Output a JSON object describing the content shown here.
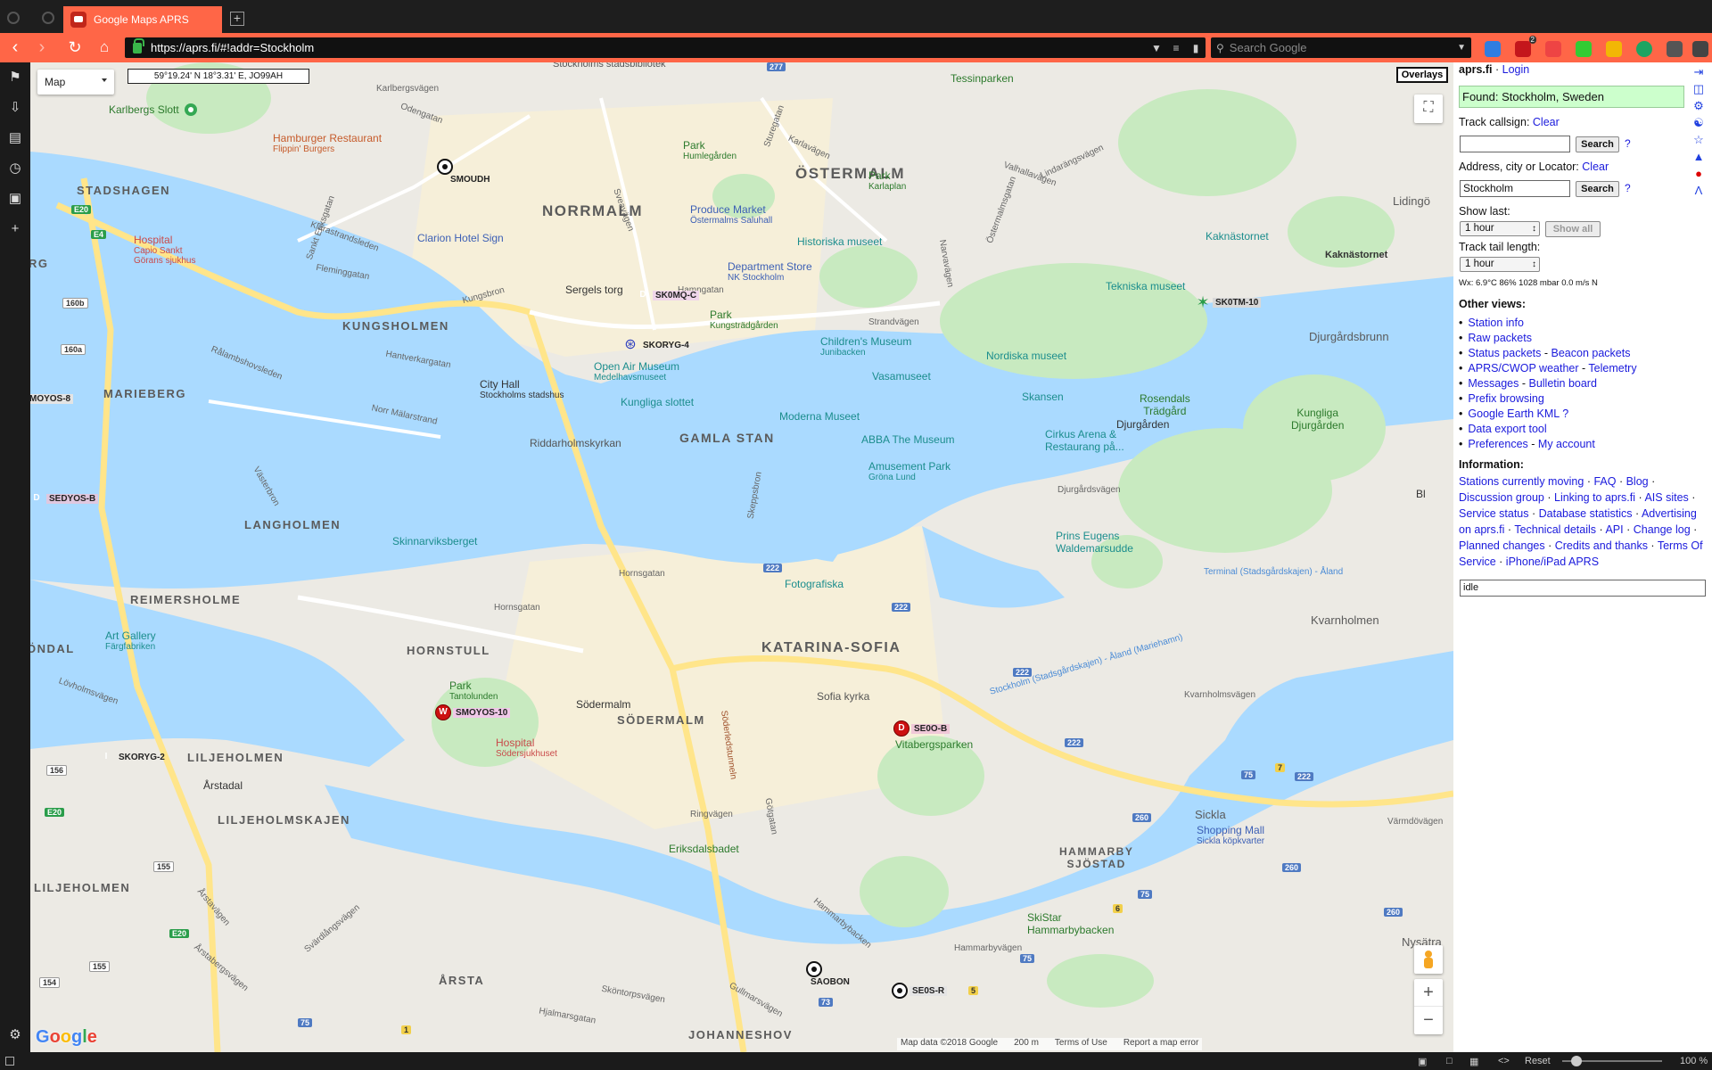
{
  "browser": {
    "tab_title": "Google Maps APRS",
    "new_tab": "+",
    "url": "https://aprs.fi/#!addr=Stockholm",
    "search_placeholder": "Search Google",
    "extension_badge": "2",
    "status": {
      "reset": "Reset",
      "zoom": "100 %"
    }
  },
  "map": {
    "map_type": "Map",
    "coords": "59°19.24' N 18°3.31' E, JO99AH",
    "overlays": "Overlays",
    "zoom_in": "+",
    "zoom_out": "−",
    "attribution": {
      "data": "Map data ©2018 Google",
      "scale": "200 m",
      "terms": "Terms of Use",
      "report": "Report a map error"
    },
    "districts": {
      "ostermalm": "ÖSTERMALM",
      "norrmalm": "NORRMALM",
      "kungsholmen": "KUNGSHOLMEN",
      "marieberg": "MARIEBERG",
      "stadshagen": "STADSHAGEN",
      "gamla_stan": "GAMLA STAN",
      "langholmen": "LANGHOLMEN",
      "reimersholme": "REIMERSHOLME",
      "hornstull": "HORNSTULL",
      "sodermalm": "SÖDERMALM",
      "katarina_sofia": "KATARINA-SOFIA",
      "liljeholmskajen": "LILJEHOLMSKAJEN",
      "liljeholmen": "LILJEHOLMEN",
      "liljeholmen2": "LILJEHOLMEN",
      "arsta": "ÅRSTA",
      "johanneshov": "JOHANNESHOV",
      "hammarby": "HAMMARBY\nSJÖSTAD",
      "ondal": "ÖNDAL",
      "rg": "RG",
      "djurgarden": "Djurgården",
      "djurgardsbrunn": "Djurgårdsbrunn",
      "kvarnholmen": "Kvarnholmen",
      "sickla": "Sickla",
      "lidingo": "Lidingö",
      "nysatra": "Nysätra",
      "tessinparken": "Tessinparken",
      "sodermalm_small": "Södermalm",
      "arstadal": "Årstadal",
      "bl": "Bl"
    },
    "roads": {
      "klarastrandsleden": "Klarastrandsleden",
      "fleminggatan": "Fleminggatan",
      "kungsbron": "Kungsbron",
      "hamngatan": "Hamngatan",
      "strandvagen": "Strandvägen",
      "norr_malarstrand": "Norr Mälarstrand",
      "hantverkargatan": "Hantverkargatan",
      "ralambshovsleden": "Rålambshovsleden",
      "hornsgatan": "Hornsgatan",
      "ringvagen": "Ringvägen",
      "sodra_leden": "Söderledstunneln",
      "gotgatan": "Götgatan",
      "valhallavagen": "Valhallavägen",
      "karlavagen": "Karlavägen",
      "narvavagen": "Narvavägen",
      "sveavagen": "Sveavägen",
      "odengatan": "Odengatan",
      "karlbergsvagen": "Karlbergsvägen",
      "djurgardsvagen": "Djurgårdsvägen",
      "kvarnholmsvagen": "Kvarnholmsvägen",
      "hammarbyvagen": "Hammarbyvägen",
      "ferry": "Stockholm (Stadsgårdskajen) - Åland (Mariehamn)",
      "ferry2": "Terminal (Stadsgårdskajen) - Åland",
      "lovholmsvagen": "Lövholmsvägen",
      "arstabergsvagen": "Årstabergsvägen",
      "hjalmarsgatan": "Hjalmarsgatan",
      "skontorpsvagen": "Sköntorpsvägen",
      "gullmarsvagen": "Gullmarsvägen",
      "sturegatan": "Sturegatan",
      "lindarangsvagen": "Lindarängsvägen",
      "skeppsbron": "Skeppsbron",
      "vasterbron": "Västerbron",
      "svardlangsvagen": "Svärdlångsvägen",
      "ostermalmsgatan": "Östermalmsgatan",
      "sankt_eriksgatan": "Sankt Eriksgatan",
      "varmdovagen": "Värmdövägen",
      "arstavagen": "Årstavägen",
      "hammarbybacken": "Hammarbybacken"
    },
    "shields": [
      "277",
      "E20",
      "E4",
      "160b",
      "160a",
      "222",
      "222",
      "222",
      "222",
      "222",
      "75",
      "75",
      "260",
      "260",
      "260",
      "75",
      "73",
      "156",
      "155",
      "155",
      "154",
      "E20",
      "E20",
      "1",
      "5",
      "6",
      "7",
      "75"
    ],
    "pois": {
      "karlbergs_slott": "Karlbergs Slott",
      "hamburger": "Hamburger Restaurant",
      "hamburger_sub": "Flippin' Burgers",
      "park_humle": "Park",
      "park_humle_sub": "Humlegården",
      "park_karlaplan": "Park",
      "park_karlaplan_sub": "Karlaplan",
      "produce": "Produce Market",
      "produce_sub": "Östermalms Saluhall",
      "historiska": "Historiska museet",
      "hospital1": "Hospital",
      "hospital1_sub": "Capio Sankt Görans sjukhus",
      "clarion": "Clarion Hotel Sign",
      "dept_store": "Department Store",
      "dept_store_sub": "NK Stockholm",
      "sergels": "Sergels torg",
      "park_kung": "Park",
      "park_kung_sub": "Kungsträdgården",
      "open_air": "Open Air Museum",
      "open_air_sub": "Medelhavsmuseet",
      "city_hall": "City Hall",
      "city_hall_sub": "Stockholms stadshus",
      "kungliga": "Kungliga slottet",
      "childrens": "Children's Museum",
      "childrens_sub": "Junibacken",
      "nordiska": "Nordiska museet",
      "vasamuseet": "Vasamuseet",
      "skansen": "Skansen",
      "moderna": "Moderna Museet",
      "abba": "ABBA The Museum",
      "cirkus": "Cirkus Arena &",
      "cirkus_sub": "Restaurang på...",
      "amusement": "Amusement Park",
      "amusement_sub": "Gröna Lund",
      "riddarholms": "Riddarholmskyrkan",
      "rosendals": "Rosendals",
      "rosendals_sub": "Trädgård",
      "kungliga_dj": "Kungliga",
      "kungliga_dj_sub": "Djurgården",
      "kaknas": "Kaknästornet",
      "kaknas2": "Kaknästornet",
      "tekniska": "Tekniska museet",
      "skinnarviks": "Skinnarviksberget",
      "fotografiska": "Fotografiska",
      "prins_eugens": "Prins Eugens",
      "prins_eugens_sub": "Waldemarsudde",
      "art_gallery": "Art Gallery",
      "art_gallery_sub": "Färgfabriken",
      "park_tanto": "Park",
      "park_tanto_sub": "Tantolunden",
      "hospital2": "Hospital",
      "hospital2_sub": "Södersjukhuset",
      "sofia": "Sofia kyrka",
      "vitabergs": "Vitabergsparken",
      "eriksdals": "Eriksdalsbadet",
      "shopping": "Shopping Mall",
      "shopping_sub": "Sickla köpkvarter",
      "skistar": "SkiStar",
      "skistar_sub": "Hammarbybacken",
      "stadsbib": "Stockholms stadsbibliotek"
    },
    "stations": {
      "smoudh": "SMOUDH",
      "sk0mq": "SK0MQ-C",
      "skoryg4": "SKORYG-4",
      "sk0tm": "SK0TM-10",
      "sedyos": "SEDYOS-B",
      "moyos8": "MOYOS-8",
      "smoyos10": "SMOYOS-10",
      "seoob": "SE0O-B",
      "skoryg2": "SKORYG-2",
      "saobon": "SAOBON",
      "seosr": "SE0S-R"
    }
  },
  "panel": {
    "site": "aprs.fi",
    "separator": " · ",
    "login": "Login",
    "found": "Found: Stockholm, Sweden",
    "track_label": "Track callsign:",
    "clear": "Clear",
    "search_btn": "Search",
    "help": "?",
    "address_label": "Address, city or Locator:",
    "address_value": "Stockholm",
    "show_last_label": "Show last:",
    "show_last_value": "1 hour",
    "show_all": "Show all",
    "tail_label": "Track tail length:",
    "tail_value": "1 hour",
    "wx": "Wx: 6.9°C 86% 1028 mbar 0.0 m/s N",
    "other_views": "Other views:",
    "views": [
      [
        "Station info"
      ],
      [
        "Raw packets"
      ],
      [
        "Status packets",
        "Beacon packets"
      ],
      [
        "APRS/CWOP weather",
        "Telemetry"
      ],
      [
        "Messages",
        "Bulletin board"
      ],
      [
        "Prefix browsing"
      ],
      [
        "Google Earth KML ?"
      ],
      [
        "Data export tool"
      ],
      [
        "Preferences",
        "My account"
      ]
    ],
    "information": "Information:",
    "info_links": [
      "Stations currently moving",
      "FAQ",
      "Blog",
      "Discussion group",
      "Linking to aprs.fi",
      "AIS sites",
      "Service status",
      "Database statistics",
      "Advertising on aprs.fi",
      "Technical details",
      "API",
      "Change log",
      "Planned changes",
      "Credits and thanks",
      "Terms Of Service",
      "iPhone/iPad APRS"
    ],
    "idle": "idle"
  },
  "colors": {
    "brand": "#ff6647",
    "water": "#aadaff",
    "park": "#c8eac0",
    "link": "#1a1adc",
    "found_bg": "#ccffcc"
  }
}
